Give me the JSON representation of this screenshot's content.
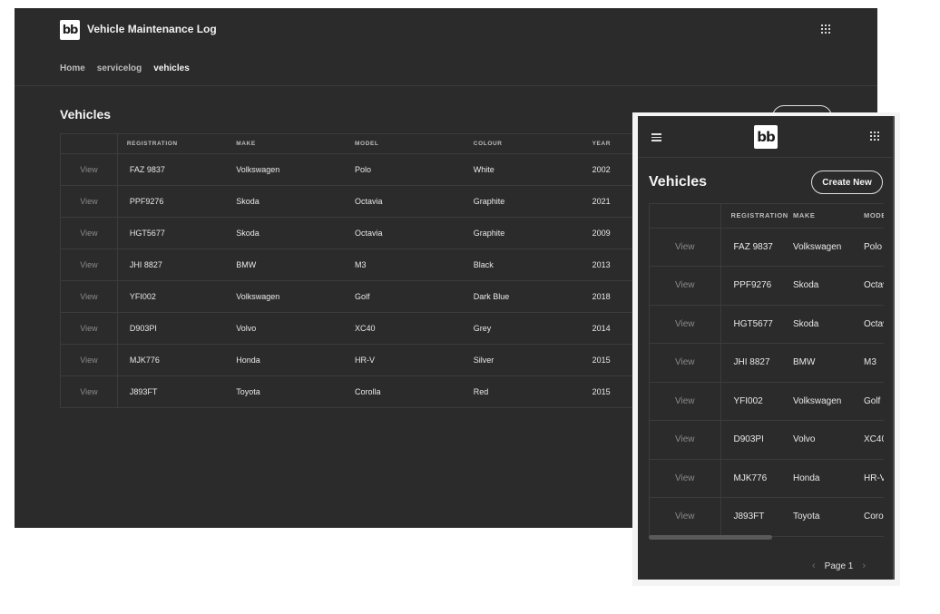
{
  "app": {
    "logo_text": "bb",
    "title": "Vehicle Maintenance Log"
  },
  "breadcrumb": [
    "Home",
    "servicelog",
    "vehicles"
  ],
  "page": {
    "title": "Vehicles",
    "create_label": "Create New",
    "view_label": "View"
  },
  "table": {
    "columns": [
      "REGISTRATION",
      "MAKE",
      "MODEL",
      "COLOUR",
      "YEAR"
    ],
    "rows": [
      {
        "registration": "FAZ 9837",
        "make": "Volkswagen",
        "model": "Polo",
        "colour": "White",
        "year": "2002"
      },
      {
        "registration": "PPF9276",
        "make": "Skoda",
        "model": "Octavia",
        "colour": "Graphite",
        "year": "2021"
      },
      {
        "registration": "HGT5677",
        "make": "Skoda",
        "model": "Octavia",
        "colour": "Graphite",
        "year": "2009"
      },
      {
        "registration": "JHI 8827",
        "make": "BMW",
        "model": "M3",
        "colour": "Black",
        "year": "2013"
      },
      {
        "registration": "YFI002",
        "make": "Volkswagen",
        "model": "Golf",
        "colour": "Dark Blue",
        "year": "2018"
      },
      {
        "registration": "D903PI",
        "make": "Volvo",
        "model": "XC40",
        "colour": "Grey",
        "year": "2014"
      },
      {
        "registration": "MJK776",
        "make": "Honda",
        "model": "HR-V",
        "colour": "Silver",
        "year": "2015"
      },
      {
        "registration": "J893FT",
        "make": "Toyota",
        "model": "Corolla",
        "colour": "Red",
        "year": "2015"
      }
    ]
  },
  "pagination": {
    "label": "Page 1",
    "prev_icon": "chevron-left-icon",
    "next_icon": "chevron-right-icon"
  },
  "icons": {
    "apps": "apps-grid-icon",
    "menu": "hamburger-menu-icon"
  },
  "colors": {
    "background": "#2b2b2b",
    "border": "#3c3c3c",
    "text": "#e8e8e8",
    "muted": "#8a8a8a"
  }
}
